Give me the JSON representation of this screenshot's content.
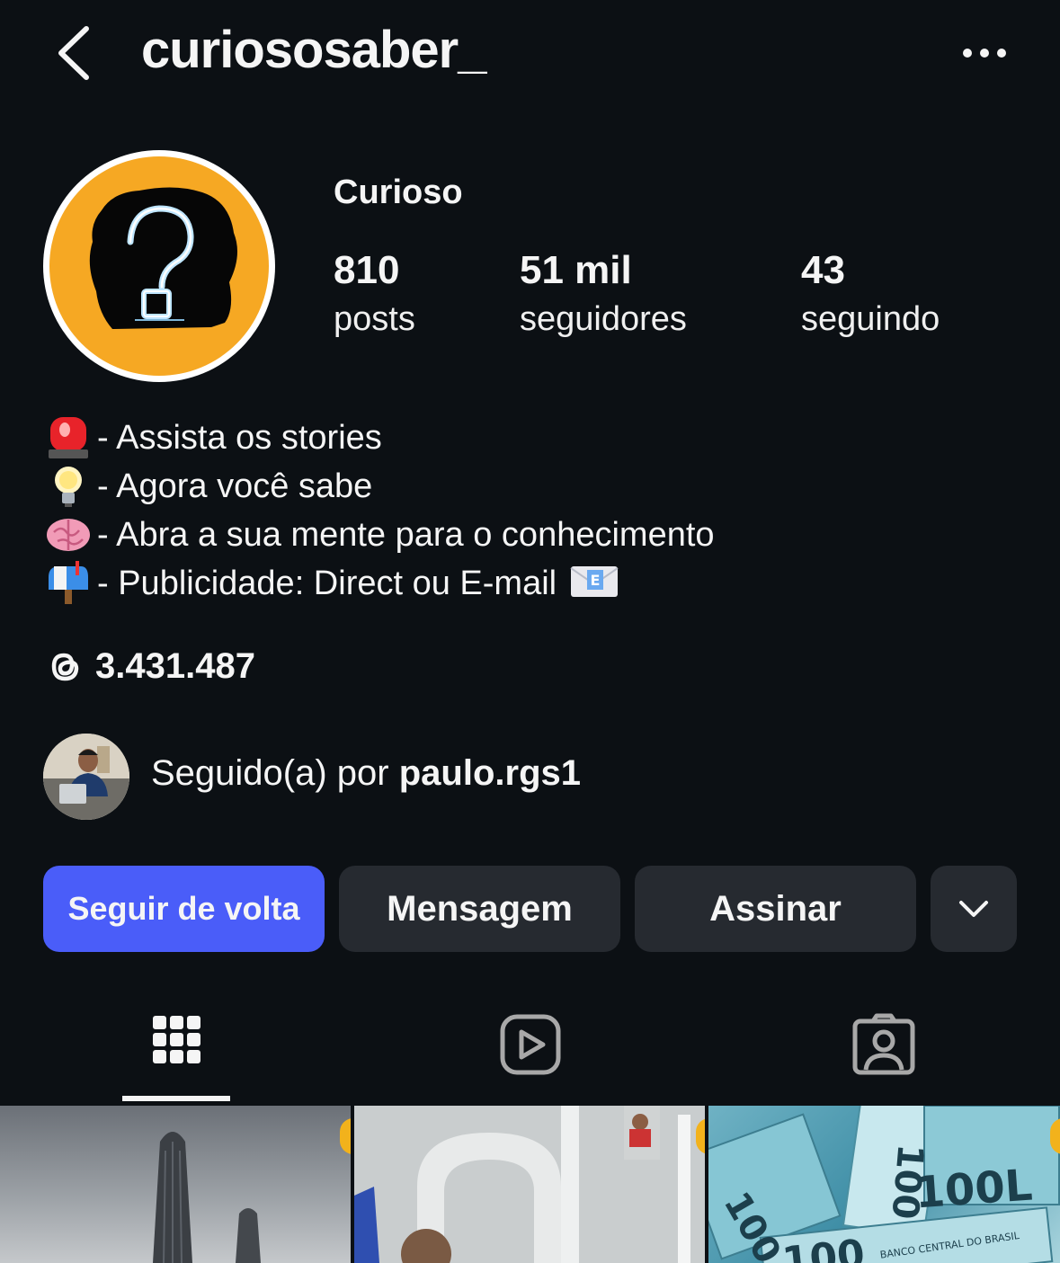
{
  "header": {
    "username": "curiososaber_"
  },
  "profile": {
    "display_name": "Curioso",
    "stats": [
      {
        "value": "810",
        "label": "posts"
      },
      {
        "value": "51 mil",
        "label": "seguidores"
      },
      {
        "value": "43",
        "label": "seguindo"
      }
    ]
  },
  "bio": [
    {
      "emoji": "siren",
      "text": "- Assista os stories"
    },
    {
      "emoji": "light-bulb",
      "text": "- Agora você sabe"
    },
    {
      "emoji": "brain",
      "text": "- Abra a sua mente para o conhecimento"
    },
    {
      "emoji": "mailbox",
      "text": "- Publicidade: Direct ou E-mail"
    }
  ],
  "threads": {
    "count": "3.431.487"
  },
  "followed_by": {
    "prefix": "Seguido(a) por ",
    "username": "paulo.rgs1"
  },
  "actions": {
    "follow_back": "Seguir de volta",
    "message": "Mensagem",
    "subscribe": "Assinar"
  },
  "tabs": {
    "active": "grid"
  },
  "posts": [
    {
      "subject": "tall-buildings"
    },
    {
      "subject": "people-construction"
    },
    {
      "subject": "brazilian-100-reais-notes"
    }
  ],
  "post3_note_text": [
    "100",
    "100L",
    "BANCO CENTRAL DO BRASIL",
    "100"
  ],
  "colors": {
    "background": "#0c1014",
    "primary_button": "#4a5df9",
    "secondary_button": "#262a30",
    "avatar_bg": "#f6a823"
  }
}
